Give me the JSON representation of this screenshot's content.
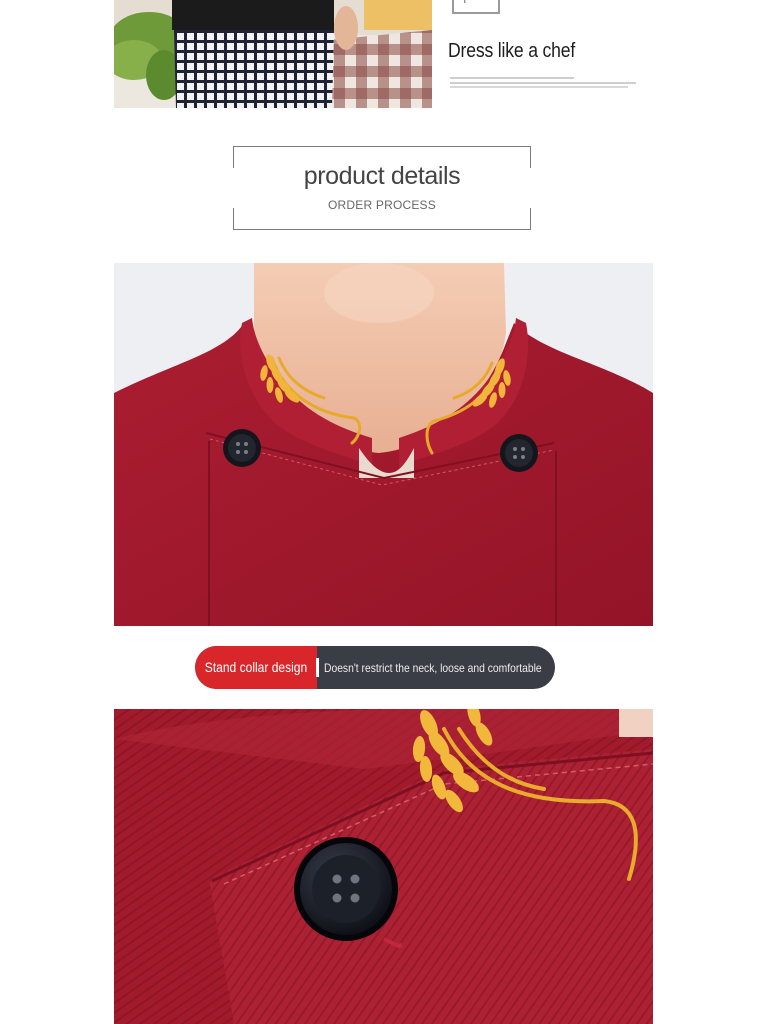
{
  "header": {
    "headline": "Dress like a chef",
    "plus_symbol": "+"
  },
  "details": {
    "title": "product details",
    "subtitle": "ORDER PROCESS"
  },
  "feature": {
    "label": "Stand collar design",
    "description": "Doesn't restrict the neck, loose and comfortable"
  },
  "colors": {
    "uniform_red": "#a4182c",
    "embroidery_gold": "#e7a92a",
    "pill_red": "#d8262b",
    "pill_dark": "#3a3d45"
  },
  "icons": [
    "plus-icon",
    "wheat-embroidery-icon",
    "button-icon"
  ]
}
